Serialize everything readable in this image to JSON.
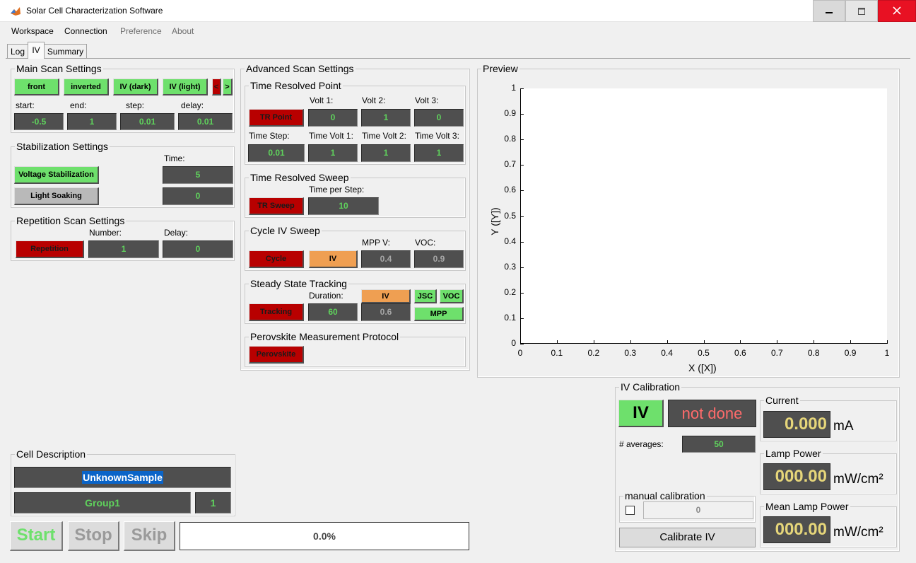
{
  "window": {
    "title": "Solar Cell Characterization Software"
  },
  "colors": {
    "accent_green": "#6ee06c",
    "alert_red": "#b80000",
    "orange": "#ef9f52",
    "field_bg": "#4f4f4f",
    "field_text": "#5fd25c",
    "meter_text": "#e6d67a",
    "not_done_text": "#ff6b6b"
  },
  "menu": {
    "workspace": "Workspace",
    "connection": "Connection",
    "preference": "Preference",
    "about": "About"
  },
  "tabs": {
    "log": "Log",
    "iv": "IV",
    "summary": "Summary"
  },
  "main_scan": {
    "title": "Main Scan Settings",
    "front": "front",
    "inverted": "inverted",
    "iv_dark": "IV (dark)",
    "iv_light": "IV (light)",
    "prev": "<",
    "next": ">",
    "start_label": "start:",
    "end_label": "end:",
    "step_label": "step:",
    "delay_label": "delay:",
    "start": "-0.5",
    "end": "1",
    "step": "0.01",
    "delay": "0.01"
  },
  "stabilization": {
    "title": "Stabilization Settings",
    "time_label": "Time:",
    "voltage_btn": "Voltage Stabilization",
    "voltage_time": "5",
    "light_btn": "Light Soaking",
    "light_time": "0"
  },
  "repetition": {
    "title": "Repetition Scan Settings",
    "number_label": "Number:",
    "delay_label": "Delay:",
    "btn": "Repetition",
    "number": "1",
    "delay": "0"
  },
  "cell_description": {
    "title": "Cell Description",
    "sample": "UnknownSample",
    "group": "Group1",
    "group_num": "1"
  },
  "controls": {
    "start": "Start",
    "stop": "Stop",
    "skip": "Skip",
    "progress": "0.0%"
  },
  "advanced": {
    "title": "Advanced Scan Settings",
    "tr_point": {
      "title": "Time Resolved Point",
      "btn": "TR Point",
      "volt1_label": "Volt 1:",
      "volt2_label": "Volt 2:",
      "volt3_label": "Volt 3:",
      "volt1": "0",
      "volt2": "1",
      "volt3": "0",
      "time_step_label": "Time Step:",
      "tv1_label": "Time Volt 1:",
      "tv2_label": "Time Volt 2:",
      "tv3_label": "Time Volt 3:",
      "time_step": "0.01",
      "tv1": "1",
      "tv2": "1",
      "tv3": "1"
    },
    "tr_sweep": {
      "title": "Time Resolved Sweep",
      "btn": "TR Sweep",
      "time_per_step_label": "Time per Step:",
      "time_per_step": "10"
    },
    "cycle": {
      "title": "Cycle IV Sweep",
      "btn": "Cycle",
      "iv_btn": "IV",
      "mpp_label": "MPP V:",
      "voc_label": "VOC:",
      "mpp": "0.4",
      "voc": "0.9"
    },
    "tracking": {
      "title": "Steady State Tracking",
      "btn": "Tracking",
      "duration_label": "Duration:",
      "duration": "60",
      "iv_btn": "IV",
      "iv_value": "0.6",
      "jsc": "JSC",
      "voc": "VOC",
      "mpp": "MPP"
    },
    "perovskite": {
      "title": "Perovskite Measurement Protocol",
      "btn": "Perovskite"
    }
  },
  "preview": {
    "title": "Preview"
  },
  "chart_data": {
    "type": "line",
    "title": "",
    "xlabel": "X ([X])",
    "ylabel": "Y ([Y])",
    "xlim": [
      0,
      1
    ],
    "ylim": [
      0,
      1
    ],
    "xticks": [
      "0",
      "0.1",
      "0.2",
      "0.3",
      "0.4",
      "0.5",
      "0.6",
      "0.7",
      "0.8",
      "0.9",
      "1"
    ],
    "yticks": [
      "0",
      "0.1",
      "0.2",
      "0.3",
      "0.4",
      "0.5",
      "0.6",
      "0.7",
      "0.8",
      "0.9",
      "1"
    ],
    "series": []
  },
  "iv_calibration": {
    "title": "IV Calibration",
    "iv_btn": "IV",
    "status": "not done",
    "averages_label": "# averages:",
    "averages": "50",
    "manual_title": "manual calibration",
    "manual_value": "0",
    "calibrate_btn": "Calibrate IV",
    "current_title": "Current",
    "current_value": "0.000",
    "current_unit": "mA",
    "lamp_title": "Lamp Power",
    "lamp_value": "000.00",
    "lamp_unit": "mW/cm²",
    "mean_lamp_title": "Mean Lamp Power",
    "mean_lamp_value": "000.00",
    "mean_lamp_unit": "mW/cm²"
  }
}
